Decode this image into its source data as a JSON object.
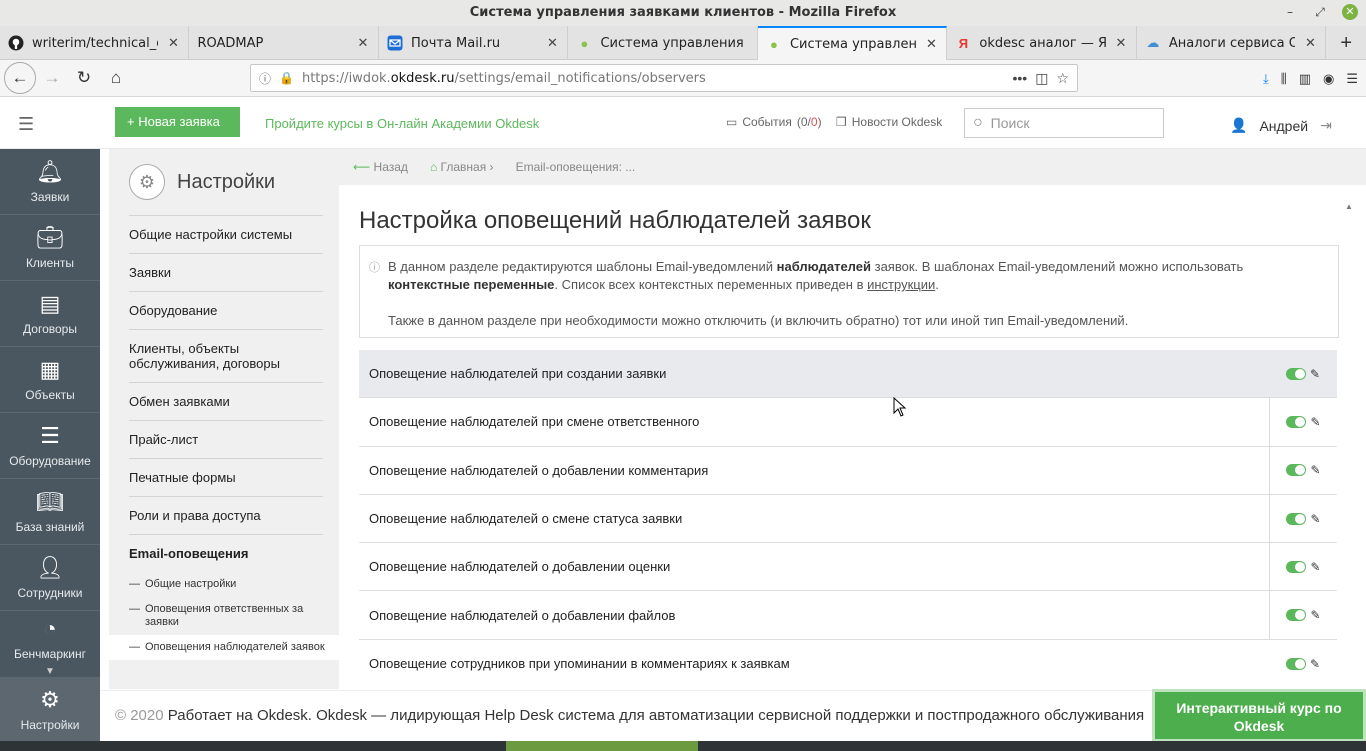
{
  "window": {
    "title": "Система управления заявками клиентов - Mozilla Firefox"
  },
  "tabs": [
    {
      "label": "writerim/technical_do",
      "icon": "github-icon"
    },
    {
      "label": "ROADMAP",
      "icon": ""
    },
    {
      "label": "Почта Mail.ru",
      "icon": "mail-icon"
    },
    {
      "label": "Система управления",
      "icon": "okdesk-icon"
    },
    {
      "label": "Система управления",
      "icon": "okdesk-icon",
      "active": true
    },
    {
      "label": "okdesc аналог — Янд",
      "icon": "yandex-icon"
    },
    {
      "label": "Аналоги сервиса Okd",
      "icon": "cloud-icon"
    }
  ],
  "nav": {
    "url_prefix": "https://iwdok.",
    "url_host": "okdesk.ru",
    "url_path": "/settings/email_notifications/observers"
  },
  "header": {
    "new_ticket": "Новая заявка",
    "academy": "Пройдите курсы в Он-лайн Академии Okdesk",
    "events_label": "События",
    "events_count": "(0/",
    "events_count_red": "0",
    "events_close": ")",
    "news": "Новости Okdesk",
    "search_placeholder": "Поиск",
    "user": "Андрей"
  },
  "rail": [
    {
      "label": "Заявки",
      "icon": "bell-icon"
    },
    {
      "label": "Клиенты",
      "icon": "briefcase-icon"
    },
    {
      "label": "Договоры",
      "icon": "documents-icon"
    },
    {
      "label": "Объекты",
      "icon": "building-icon"
    },
    {
      "label": "Оборудование",
      "icon": "server-icon"
    },
    {
      "label": "База знаний",
      "icon": "book-icon"
    },
    {
      "label": "Сотрудники",
      "icon": "person-icon"
    },
    {
      "label": "Бенчмаркинг",
      "icon": "gauge-icon"
    },
    {
      "label": "Настройки",
      "icon": "gear-icon"
    }
  ],
  "settings": {
    "title": "Настройки",
    "items": [
      "Общие настройки системы",
      "Заявки",
      "Оборудование",
      "Клиенты, объекты обслуживания, договоры",
      "Обмен заявками",
      "Прайс-лист",
      "Печатные формы",
      "Роли и права доступа",
      "Email-оповещения"
    ],
    "subitems": [
      "Общие настройки",
      "Оповещения ответственных за заявки",
      "Оповещения наблюдателей заявок"
    ]
  },
  "breadcrumbs": {
    "back": "Назад",
    "home": "Главная",
    "current": "Email-оповещения: ..."
  },
  "main": {
    "title": "Настройка оповещений наблюдателей заявок",
    "info_1a": "В данном разделе редактируются шаблоны Email-уведомлений ",
    "info_1b": "наблюдателей",
    "info_1c": " заявок. В шаблонах Email-уведомлений можно использовать ",
    "info_1d": "контекстные переменные",
    "info_1e": ". Список всех контекстных переменных приведен в ",
    "info_1f": "инструкции",
    "info_1g": ".",
    "info_2": "Также в данном разделе при необходимости можно отключить (и включить обратно) тот или иной тип Email-уведомлений.",
    "notifications": [
      "Оповещение наблюдателей при создании заявки",
      "Оповещение наблюдателей при смене ответственного",
      "Оповещение наблюдателей о добавлении комментария",
      "Оповещение наблюдателей о смене статуса заявки",
      "Оповещение наблюдателей о добавлении оценки",
      "Оповещение наблюдателей о добавлении файлов",
      "Оповещение сотрудников при упоминании в комментариях к заявкам"
    ]
  },
  "footer": {
    "copy": "© 2020",
    "text": "Работает на Okdesk. Okdesk — лидирующая Help Desk система для автоматизации сервисной поддержки и постпродажного обслуживания",
    "course": "Интерактивный курс по Okdesk"
  },
  "colors": {
    "brand_green": "#5cb85c",
    "rail_bg": "#4b5760",
    "accent_blue": "#0a84ff"
  }
}
